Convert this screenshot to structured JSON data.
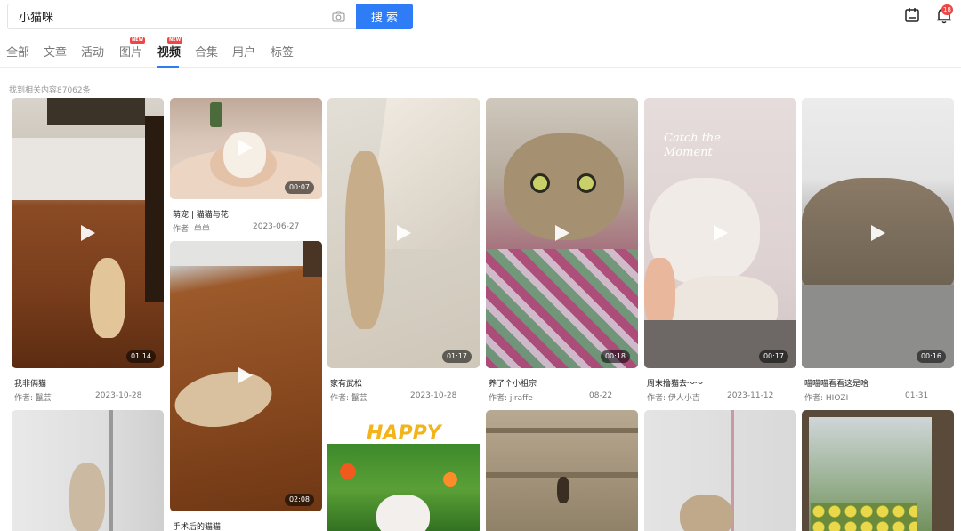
{
  "search": {
    "value": "小猫咪",
    "button": "搜 索"
  },
  "header": {
    "notification_count": "18"
  },
  "tabs": [
    {
      "label": "全部",
      "new": false
    },
    {
      "label": "文章",
      "new": false
    },
    {
      "label": "活动",
      "new": false
    },
    {
      "label": "图片",
      "new": true
    },
    {
      "label": "视频",
      "new": true,
      "active": true
    },
    {
      "label": "合集",
      "new": false
    },
    {
      "label": "用户",
      "new": false
    },
    {
      "label": "标签",
      "new": false
    }
  ],
  "new_badge": "NEW",
  "result_count": "找到相关内容87062条",
  "videos": [
    {
      "title": "我非俩猫",
      "author": "作者: 鬣芸",
      "date": "2023-10-28",
      "duration": "01:14"
    },
    {
      "title": "萌宠 | 猫猫与花",
      "author": "作者: 单单",
      "date": "2023-06-27",
      "duration": "00:07"
    },
    {
      "title": "手术后的猫猫",
      "duration": "02:08"
    },
    {
      "title": "家有武松",
      "author": "作者: 鬣芸",
      "date": "2023-10-28",
      "duration": "01:17"
    },
    {
      "title": "养了个小祖宗",
      "author": "作者: jiraffe",
      "date": "08-22",
      "duration": "00:18"
    },
    {
      "title": "周末撸猫去～～",
      "author": "作者: 伊人小吉",
      "date": "2023-11-12",
      "duration": "00:17"
    },
    {
      "title": "喵喵喵看看这是啥",
      "author": "作者: HIOZI",
      "date": "01-31",
      "duration": "00:16"
    }
  ],
  "thumb_overlay": {
    "happy": "HAPPY",
    "catch": "Catch the Moment"
  }
}
